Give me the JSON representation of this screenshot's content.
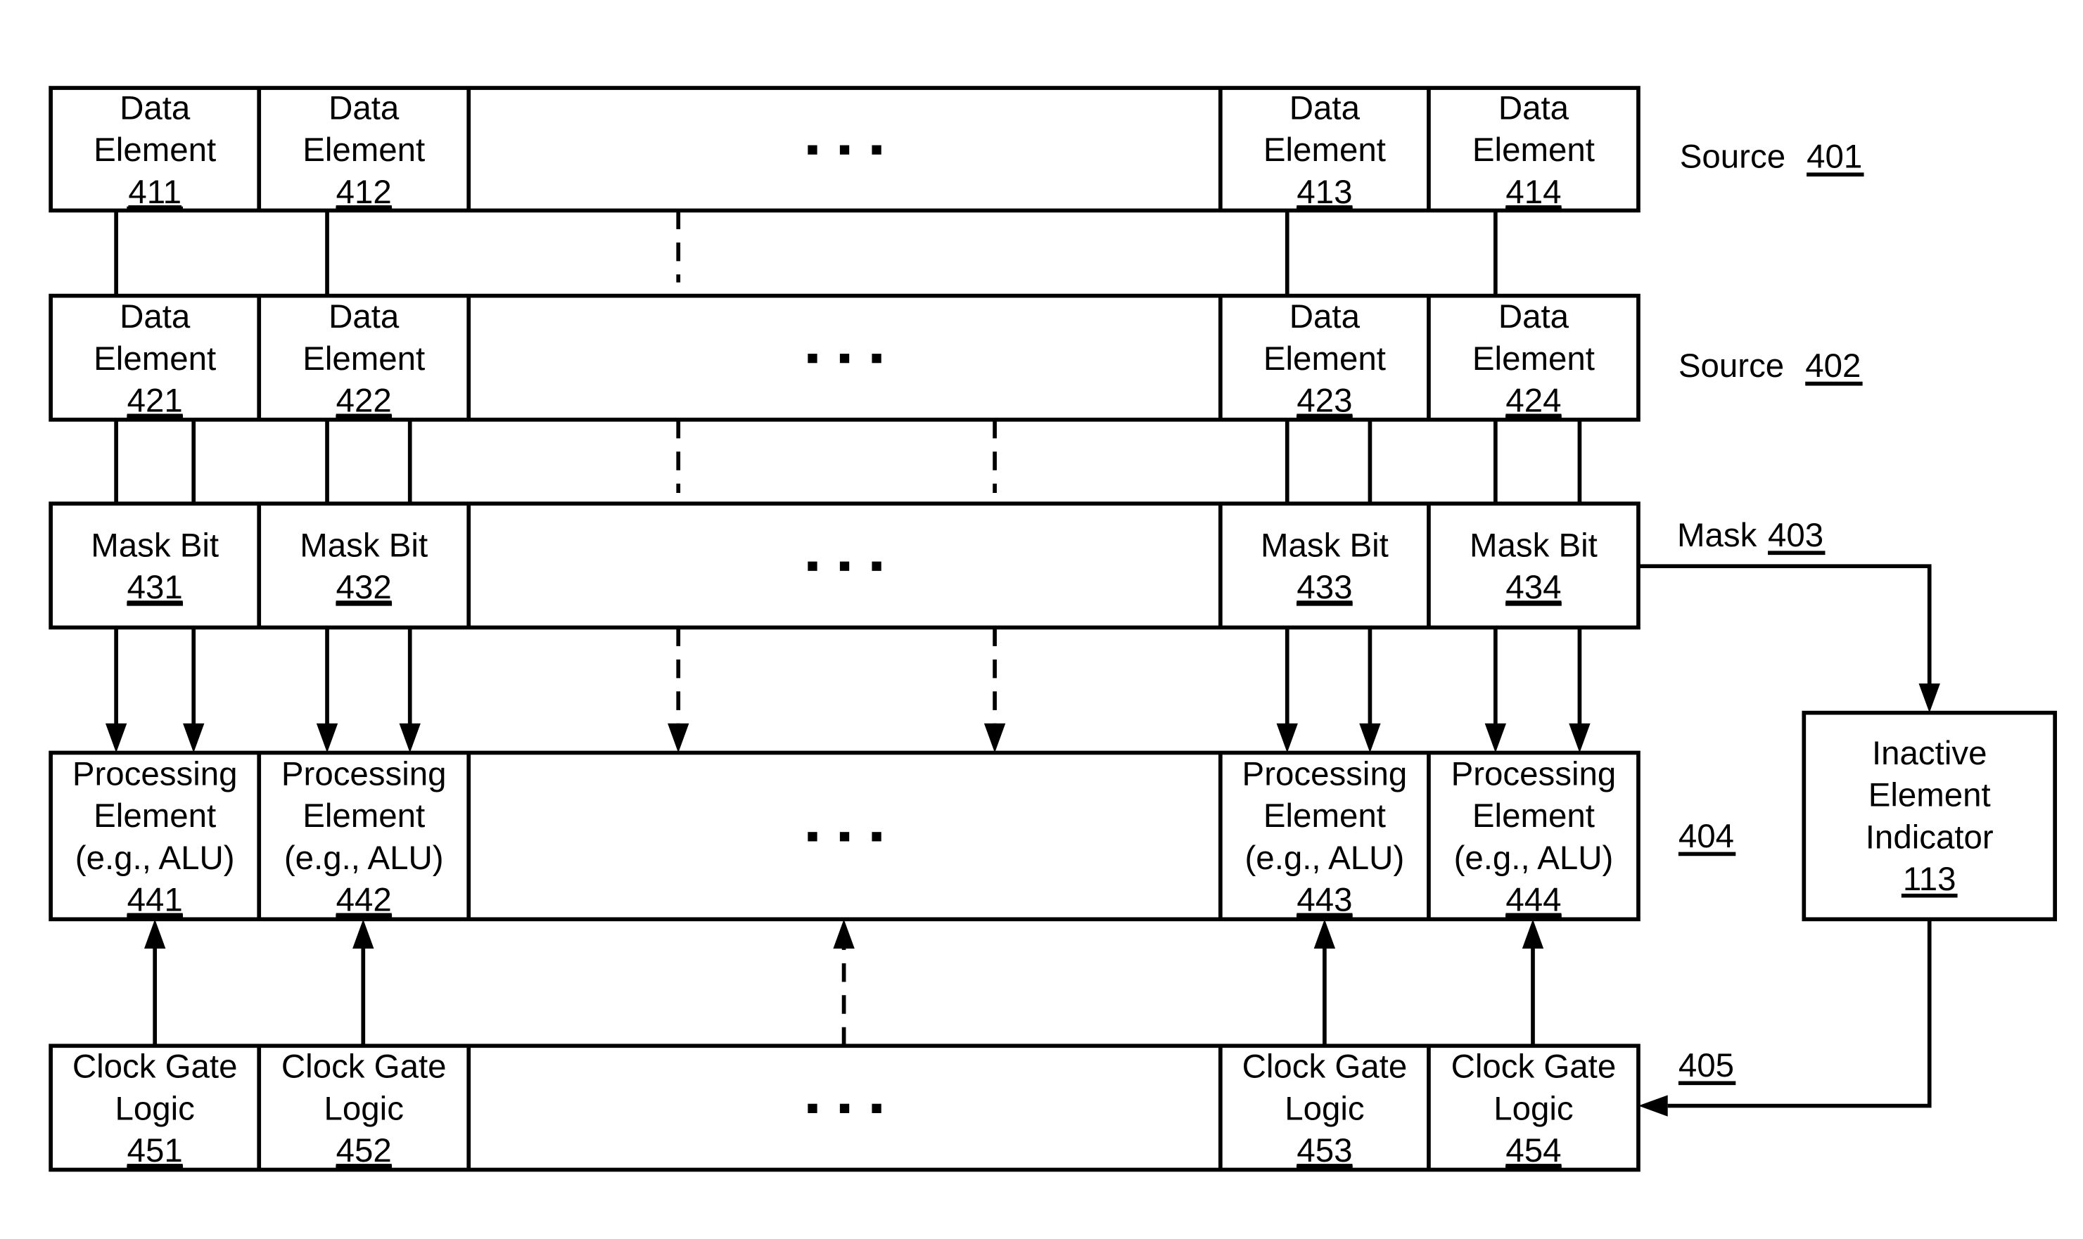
{
  "diagram": {
    "rows": [
      {
        "id": "source-401",
        "side_label": "Source",
        "side_ref": "401",
        "cells": [
          {
            "lines": [
              "Data",
              "Element"
            ],
            "ref": "411"
          },
          {
            "lines": [
              "Data",
              "Element"
            ],
            "ref": "412"
          },
          {
            "ellipsis": "..."
          },
          {
            "lines": [
              "Data",
              "Element"
            ],
            "ref": "413"
          },
          {
            "lines": [
              "Data",
              "Element"
            ],
            "ref": "414"
          }
        ]
      },
      {
        "id": "source-402",
        "side_label": "Source",
        "side_ref": "402",
        "cells": [
          {
            "lines": [
              "Data",
              "Element"
            ],
            "ref": "421"
          },
          {
            "lines": [
              "Data",
              "Element"
            ],
            "ref": "422"
          },
          {
            "ellipsis": "..."
          },
          {
            "lines": [
              "Data",
              "Element"
            ],
            "ref": "423"
          },
          {
            "lines": [
              "Data",
              "Element"
            ],
            "ref": "424"
          }
        ]
      },
      {
        "id": "mask-403",
        "side_label": "Mask",
        "side_ref": "403",
        "cells": [
          {
            "lines": [
              "Mask Bit"
            ],
            "ref": "431"
          },
          {
            "lines": [
              "Mask Bit"
            ],
            "ref": "432"
          },
          {
            "ellipsis": "..."
          },
          {
            "lines": [
              "Mask Bit"
            ],
            "ref": "433"
          },
          {
            "lines": [
              "Mask Bit"
            ],
            "ref": "434"
          }
        ]
      },
      {
        "id": "processing-404",
        "side_label": "",
        "side_ref": "404",
        "cells": [
          {
            "lines": [
              "Processing",
              "Element",
              "(e.g., ALU)"
            ],
            "ref": "441"
          },
          {
            "lines": [
              "Processing",
              "Element",
              "(e.g., ALU)"
            ],
            "ref": "442"
          },
          {
            "ellipsis": "..."
          },
          {
            "lines": [
              "Processing",
              "Element",
              "(e.g., ALU)"
            ],
            "ref": "443"
          },
          {
            "lines": [
              "Processing",
              "Element",
              "(e.g., ALU)"
            ],
            "ref": "444"
          }
        ]
      },
      {
        "id": "clock-gate-405",
        "side_label": "",
        "side_ref": "405",
        "cells": [
          {
            "lines": [
              "Clock Gate",
              "Logic"
            ],
            "ref": "451"
          },
          {
            "lines": [
              "Clock Gate",
              "Logic"
            ],
            "ref": "452"
          },
          {
            "ellipsis": "..."
          },
          {
            "lines": [
              "Clock Gate",
              "Logic"
            ],
            "ref": "453"
          },
          {
            "lines": [
              "Clock Gate",
              "Logic"
            ],
            "ref": "454"
          }
        ]
      }
    ],
    "inactive_indicator": {
      "lines": [
        "Inactive",
        "Element",
        "Indicator"
      ],
      "ref": "113"
    }
  }
}
